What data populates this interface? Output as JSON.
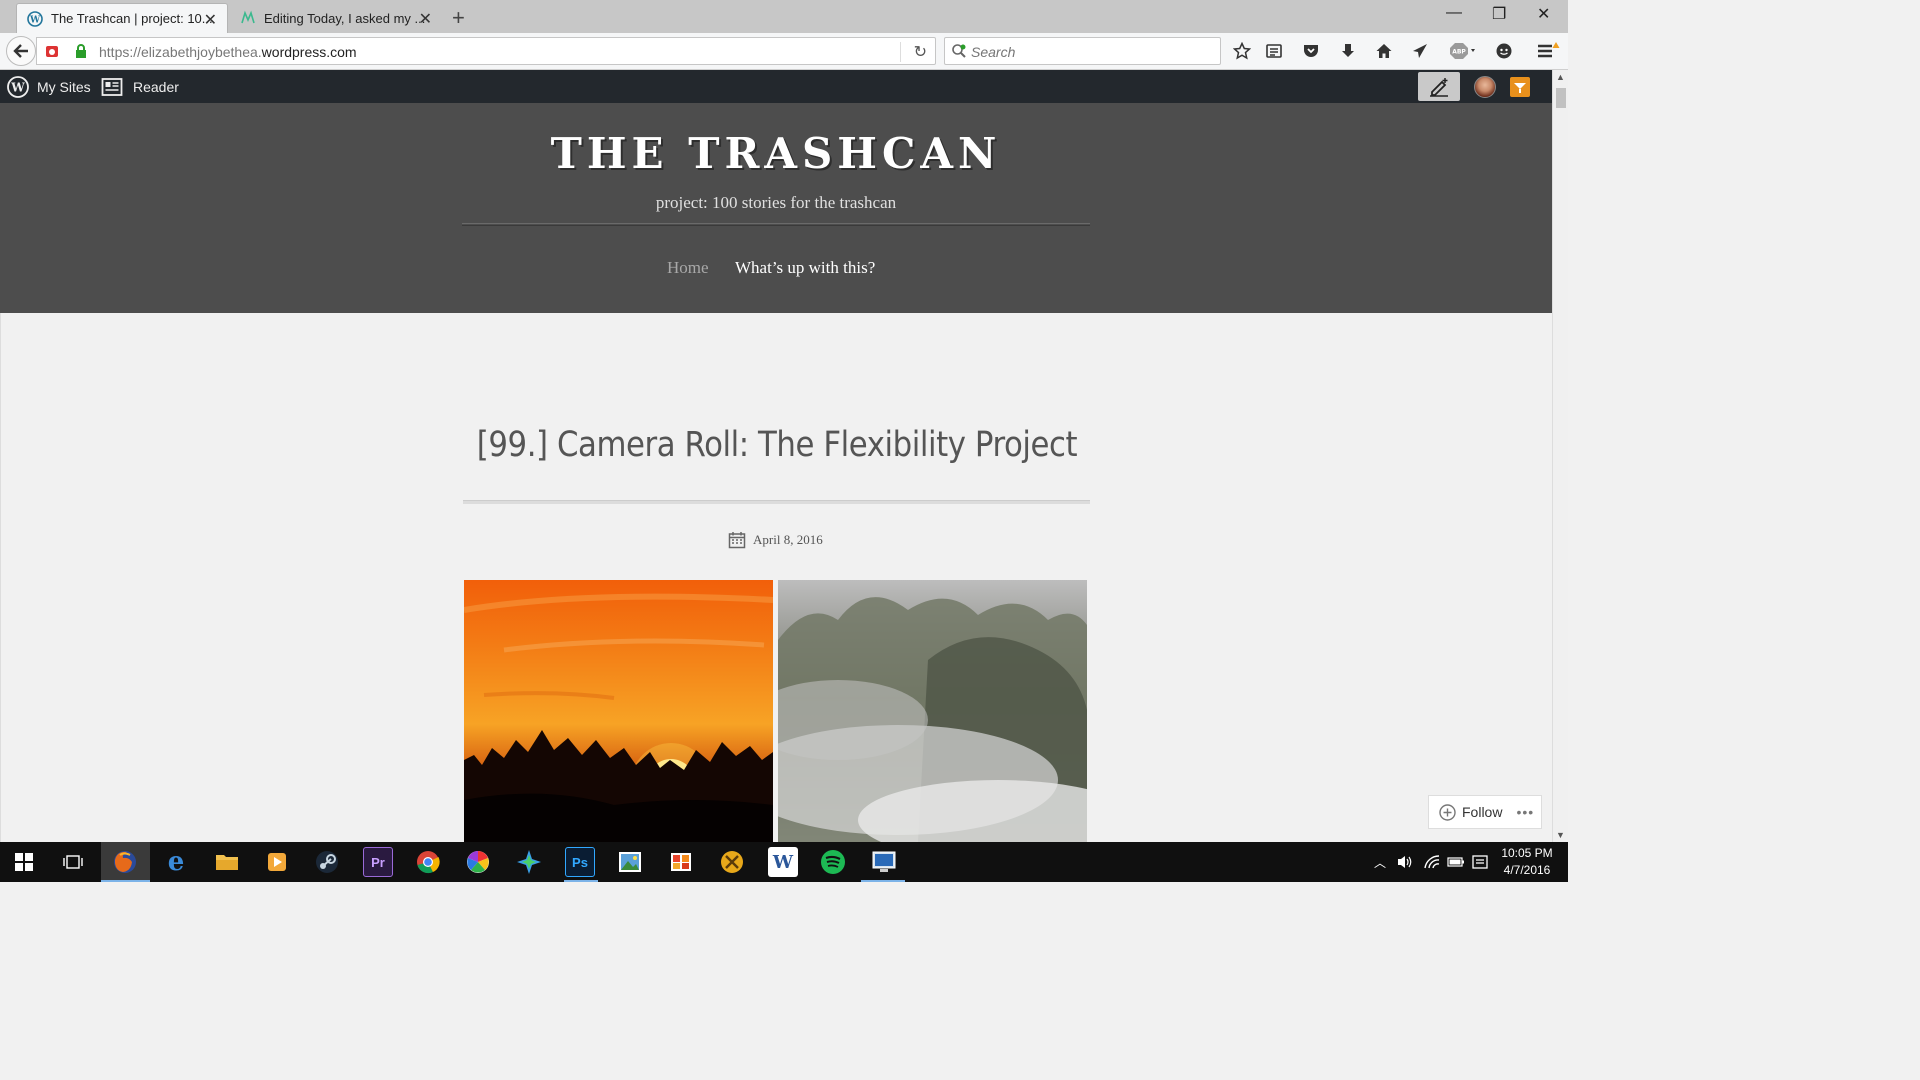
{
  "browser": {
    "tabs": [
      {
        "label": "The Trashcan | project: 10...",
        "active": true,
        "icon": "wordpress-icon"
      },
      {
        "label": "Editing Today, I asked my ...",
        "active": false,
        "icon": "editor-icon"
      }
    ],
    "url_prefix": "https://elizabethjoybethea.",
    "url_domain": "wordpress.com",
    "search_placeholder": "Search"
  },
  "wp_admin_bar": {
    "my_sites": "My Sites",
    "reader": "Reader"
  },
  "site": {
    "title": "THE TRASHCAN",
    "tagline": "project: 100 stories for the trashcan",
    "nav": [
      {
        "label": "Home"
      },
      {
        "label": "What’s up with this?"
      }
    ]
  },
  "post": {
    "title": "[99.] Camera Roll: The Flexibility Project",
    "date": "April 8, 2016"
  },
  "follow": {
    "label": "Follow",
    "more": "•••"
  },
  "taskbar": {
    "time": "10:05 PM",
    "date": "4/7/2016",
    "apps": [
      "firefox",
      "edge",
      "file-explorer",
      "media-player",
      "steam",
      "premiere",
      "chrome",
      "picasa",
      "nox",
      "photoshop",
      "photos",
      "office",
      "pickaxe",
      "word",
      "spotify",
      "remote-desktop"
    ]
  },
  "colors": {
    "header_bg": "#4d4d4d",
    "admin_bar_bg": "#23282d",
    "content_bg": "#f1f1f1",
    "taskbar_bg": "#101010"
  }
}
